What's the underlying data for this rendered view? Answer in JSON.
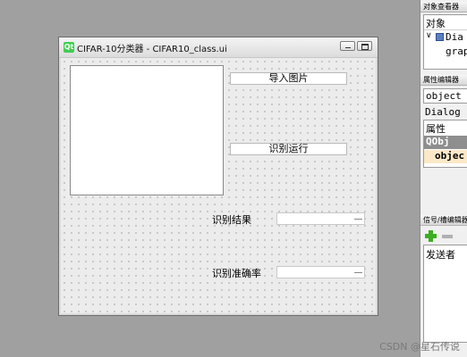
{
  "window": {
    "title": "CIFAR-10分类器 - CIFAR10_class.ui",
    "icon": "qt-logo-icon"
  },
  "form": {
    "import_button": "导入图片",
    "run_button": "识别运行",
    "result_label": "识别结果",
    "accuracy_label": "识别准确率",
    "result_value": "",
    "accuracy_value": ""
  },
  "object_inspector": {
    "title": "对象查看器",
    "header": "对象",
    "tree": [
      "Dia",
      "grap"
    ]
  },
  "property_editor": {
    "title": "属性编辑器",
    "filter": "object",
    "class": "Dialog",
    "header": "属性",
    "group": "QObj",
    "property": "objec"
  },
  "signal_editor": {
    "title": "信号/槽编辑器",
    "header": "发送者"
  },
  "watermark": "CSDN @星石传说"
}
